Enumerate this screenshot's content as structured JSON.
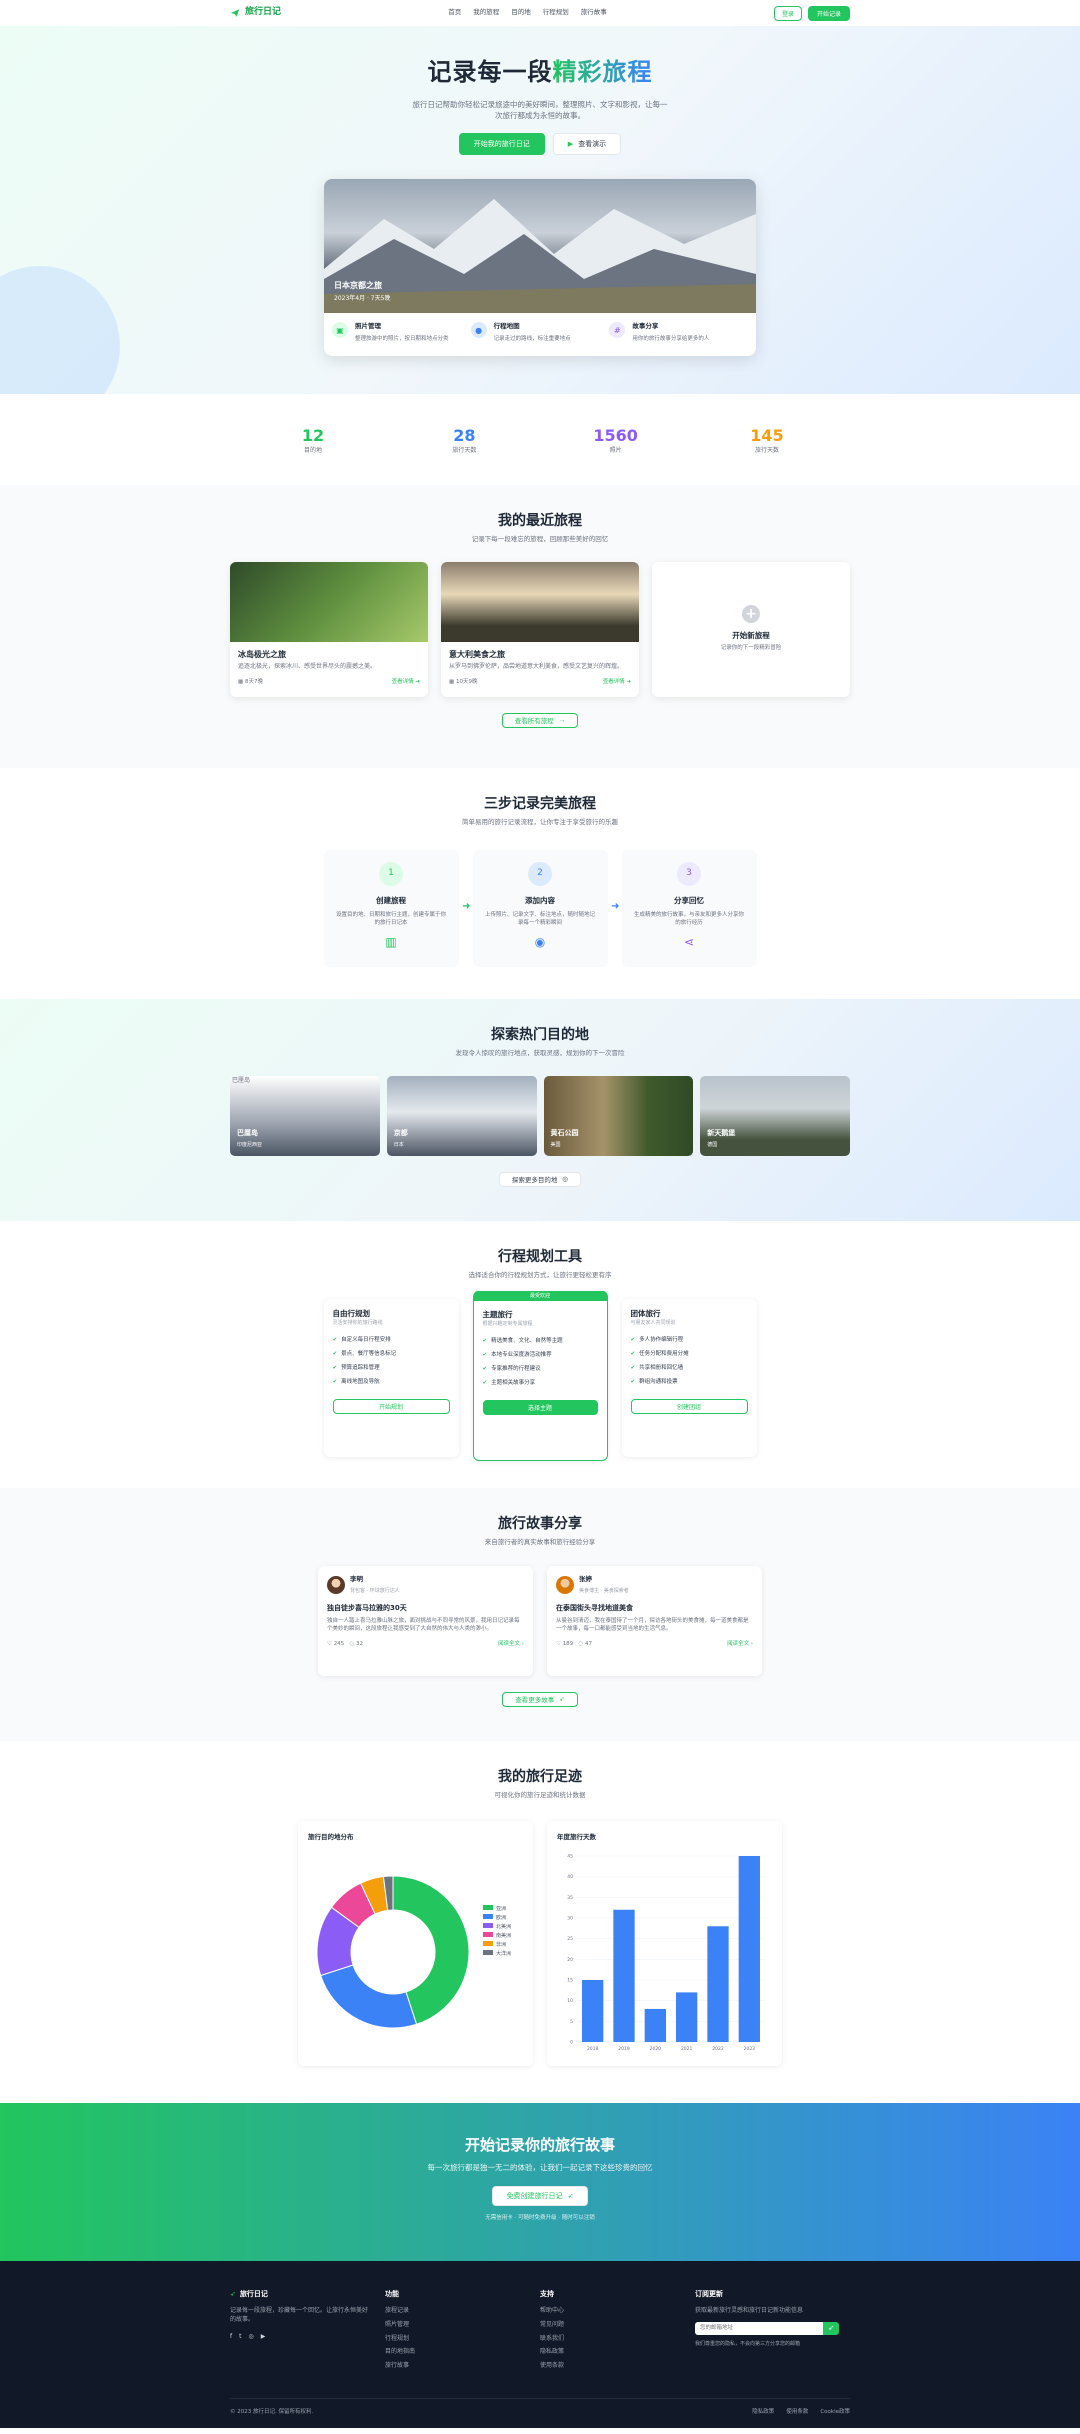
{
  "nav": {
    "logo": "旅行日记",
    "links": [
      "首页",
      "我的旅程",
      "目的地",
      "行程规划",
      "旅行故事"
    ],
    "login": "登录",
    "start": "开始记录"
  },
  "hero": {
    "title_a": "记录每一段",
    "title_b": "精彩旅程",
    "subtitle": "旅行日记帮助你轻松记录旅途中的美好瞬间，整理照片、文字和影视，让每一次旅行都成为永恒的故事。",
    "btn_primary": "开始我的旅行日记",
    "btn_secondary": "查看演示",
    "card_title": "日本京都之旅",
    "card_date": "2023年4月 · 7天5晚",
    "features": [
      {
        "title": "照片管理",
        "desc": "整理旅游中的照片，按日期和地点分类"
      },
      {
        "title": "行程地图",
        "desc": "记录走过的路线，标注重要地点"
      },
      {
        "title": "故事分享",
        "desc": "用你的旅行故事分享给更多的人"
      }
    ]
  },
  "stats": [
    {
      "value": "12",
      "label": "目的地",
      "color": "#22c55e"
    },
    {
      "value": "28",
      "label": "旅行天数",
      "color": "#3b82f6"
    },
    {
      "value": "1560",
      "label": "照片",
      "color": "#8b5cf6"
    },
    {
      "value": "145",
      "label": "旅行天数",
      "color": "#f59e0b"
    }
  ],
  "recent": {
    "title": "我的最近旅程",
    "subtitle": "记录下每一段难忘的旅程，回顾那些美好的回忆",
    "trips": [
      {
        "title": "冰岛极光之旅",
        "desc": "追逐北极光，探索冰川、感受世界尽头的震撼之美。",
        "meta": "8天7晚",
        "more": "查看详情"
      },
      {
        "title": "意大利美食之旅",
        "desc": "从罗马到佛罗伦萨，品尝地道意大利美食，感受文艺复兴的辉煌。",
        "meta": "10天9晚",
        "more": "查看详情"
      }
    ],
    "new_title": "开始新旅程",
    "new_desc": "记录你的下一段精彩冒险",
    "all_btn": "查看所有旅程"
  },
  "steps": {
    "title": "三步记录完美旅程",
    "subtitle": "简单易用的旅行记录流程，让你专注于享受旅行的乐趣",
    "items": [
      {
        "num": "1",
        "title": "创建旅程",
        "desc": "设置目的地、日期和旅行主题，创建专属于你的旅行日记本"
      },
      {
        "num": "2",
        "title": "添加内容",
        "desc": "上传照片、记录文字、标注地点，随时随地记录每一个精彩瞬间"
      },
      {
        "num": "3",
        "title": "分享回忆",
        "desc": "生成精美的旅行故事，与亲友和更多人分享你的旅行经历"
      }
    ]
  },
  "destinations": {
    "title": "探索热门目的地",
    "subtitle": "发现令人惊叹的旅行地点，获取灵感，规划你的下一次冒险",
    "items": [
      {
        "name": "巴厘岛",
        "sub": "印度尼西亚",
        "alt": "巴厘岛"
      },
      {
        "name": "京都",
        "sub": "日本"
      },
      {
        "name": "黄石公园",
        "sub": "美国"
      },
      {
        "name": "新天鹅堡",
        "sub": "德国"
      }
    ],
    "more": "探索更多目的地"
  },
  "plans": {
    "title": "行程规划工具",
    "subtitle": "选择适合你的行程规划方式，让旅行更轻松更有序",
    "items": [
      {
        "title": "自由行规划",
        "desc": "灵活安排你的旅行路线",
        "features": [
          "自定义每日行程安排",
          "景点、餐厅等信息标记",
          "预算追踪和管理",
          "离线地图及导航"
        ],
        "btn": "开始规划"
      },
      {
        "title": "主题旅行",
        "desc": "根据兴趣定制专属旅程",
        "badge": "最受欢迎",
        "features": [
          "精选美食、文化、自然等主题",
          "本地专业深度游活动推荐",
          "专家推荐的行程建议",
          "主题相关故事分享"
        ],
        "btn": "选择主题"
      },
      {
        "title": "团体旅行",
        "desc": "与朋友家人共同规划",
        "features": [
          "多人协作编辑行程",
          "任务分配和费用分摊",
          "共享相册和回忆墙",
          "群组沟通和投票"
        ],
        "btn": "创建团组"
      }
    ]
  },
  "stories": {
    "title": "旅行故事分享",
    "subtitle": "来自旅行者的真实故事和旅行经验分享",
    "items": [
      {
        "name": "李明",
        "meta": "背包客 · 环球旅行达人",
        "title": "独自徒步喜马拉雅的30天",
        "text": "独自一人踏上喜马拉雅山脉之旅，面对挑战与不同寻常的风景，我用日记记录每个美妙的瞬间，这段旅程让我感受到了大自然的伟大与人类的渺小。",
        "likes": "245",
        "comments": "32",
        "more": "阅读全文"
      },
      {
        "name": "张婷",
        "meta": "美食博主 · 美食探索者",
        "title": "在泰国街头寻找地道美食",
        "text": "从曼谷到清迈，我在泰国待了一个月，探访各地街头的美食摊，每一道美食都是一个故事，每一口都能感受到当地的生活气息。",
        "likes": "189",
        "comments": "47",
        "more": "阅读全文"
      }
    ],
    "more": "查看更多故事"
  },
  "footprint": {
    "title": "我的旅行足迹",
    "subtitle": "可视化你的旅行足迹和统计数据"
  },
  "chart_data": [
    {
      "type": "pie",
      "title": "旅行目的地分布",
      "labels": [
        "亚洲",
        "欧洲",
        "北美洲",
        "南美洲",
        "非洲",
        "大洋洲"
      ],
      "values": [
        45,
        25,
        15,
        8,
        5,
        2
      ],
      "colors": [
        "#22c55e",
        "#3b82f6",
        "#8b5cf6",
        "#ec4899",
        "#f59e0b",
        "#6b7280"
      ],
      "legend": "right"
    },
    {
      "type": "bar",
      "title": "年度旅行天数",
      "categories": [
        "2018",
        "2019",
        "2020",
        "2021",
        "2022",
        "2023"
      ],
      "values": [
        15,
        32,
        8,
        12,
        28,
        45
      ],
      "ylim": [
        0,
        45
      ],
      "yticks": [
        0,
        5,
        10,
        15,
        20,
        25,
        30,
        35,
        40,
        45
      ],
      "color": "#3b82f6"
    }
  ],
  "cta": {
    "title": "开始记录你的旅行故事",
    "subtitle": "每一次旅行都是独一无二的体验，让我们一起记录下这些珍贵的回忆",
    "btn": "免费创建旅行日记",
    "note": "无需信用卡 · 可随时免费升级 · 随时可以注销"
  },
  "footer": {
    "brand": "旅行日记",
    "desc": "记录每一段旅程，珍藏每一个回忆。让旅行永恒美好的故事。",
    "cols": [
      {
        "title": "功能",
        "items": [
          "旅程记录",
          "照片管理",
          "行程规划",
          "目的地指南",
          "旅行故事"
        ]
      },
      {
        "title": "支持",
        "items": [
          "帮助中心",
          "常见问题",
          "联系我们",
          "隐私政策",
          "使用条款"
        ]
      }
    ],
    "sub_title": "订阅更新",
    "sub_desc": "获取最新旅行灵感和旅行日记新功能信息",
    "sub_placeholder": "您的邮箱地址",
    "sub_note": "我们尊重您的隐私，不会向第三方分享您的邮箱",
    "copyright": "© 2023 旅行日记. 保留所有权利.",
    "bottom_links": [
      "隐私政策",
      "使用条款",
      "Cookie政策"
    ]
  }
}
